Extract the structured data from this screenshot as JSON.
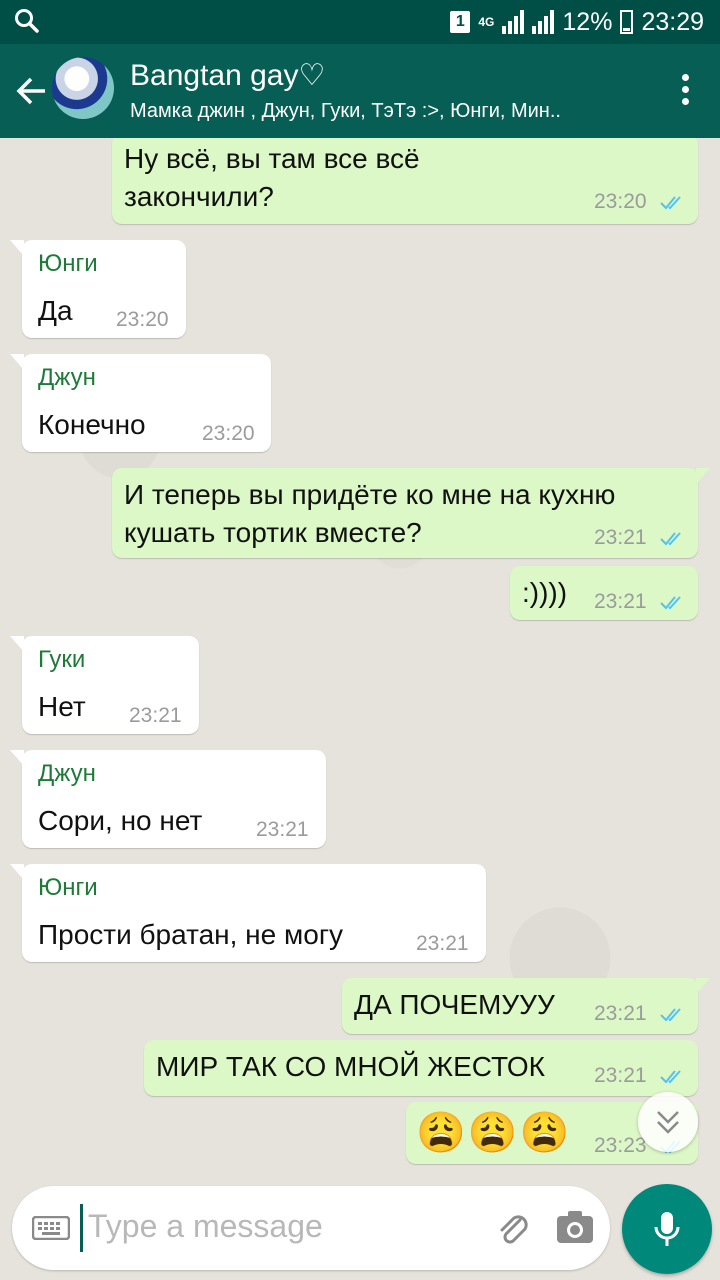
{
  "status_bar": {
    "sim_slot": "1",
    "network": "4G",
    "battery": "12%",
    "time": "23:29"
  },
  "header": {
    "title": "Bangtan gay♡",
    "subtitle": "Мамка джин , Джун, Гуки, ТэТэ :>, Юнги, Мин.."
  },
  "messages": [
    {
      "dir": "out",
      "text": "Ну всё, вы там все всё\nзакончили?",
      "time": "23:20"
    },
    {
      "dir": "in",
      "sender": "Юнги",
      "text": "Да",
      "time": "23:20"
    },
    {
      "dir": "in",
      "sender": "Джун",
      "text": "Конечно",
      "time": "23:20"
    },
    {
      "dir": "out",
      "text": "И теперь вы придёте ко мне на кухню\nкушать тортик вместе?",
      "time": "23:21"
    },
    {
      "dir": "out",
      "text": ":))))",
      "time": "23:21"
    },
    {
      "dir": "in",
      "sender": "Гуки",
      "text": "Нет",
      "time": "23:21"
    },
    {
      "dir": "in",
      "sender": "Джун",
      "text": "Сори, но нет",
      "time": "23:21"
    },
    {
      "dir": "in",
      "sender": "Юнги",
      "text": "Прости братан, не могу",
      "time": "23:21"
    },
    {
      "dir": "out",
      "text": "ДА ПОЧЕМУУУ",
      "time": "23:21"
    },
    {
      "dir": "out",
      "text": "МИР ТАК СО МНОЙ ЖЕСТОК",
      "time": "23:21"
    },
    {
      "dir": "out",
      "text": "😩😩😩",
      "time": "23:23"
    }
  ],
  "composer": {
    "placeholder": "Type a message"
  },
  "colors": {
    "status_bar": "#004f46",
    "app_bar": "#075e54",
    "outgoing_bubble": "#dcf8c6",
    "incoming_bubble": "#ffffff",
    "sender_name": "#1f7a3a",
    "read_ticks": "#4fc3f7",
    "mic_button": "#00897b"
  }
}
